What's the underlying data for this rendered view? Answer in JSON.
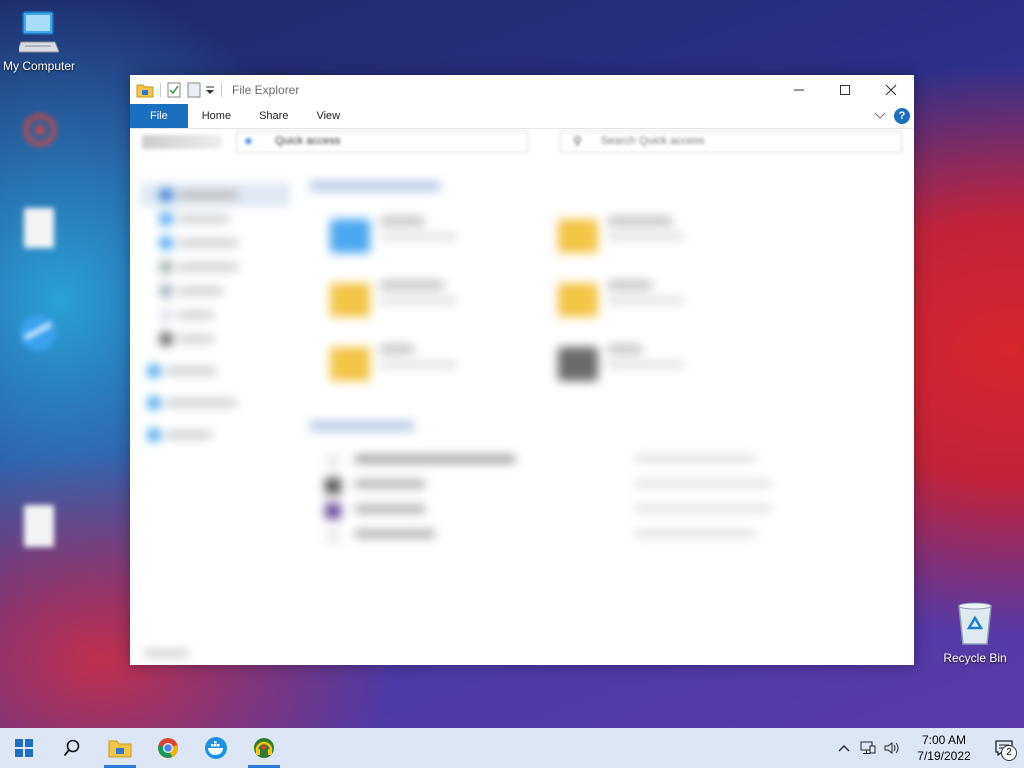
{
  "desktop": {
    "icons": [
      {
        "label": "My Computer",
        "icon": "computer-icon"
      },
      {
        "label": "Recycle Bin",
        "icon": "recycle-bin-icon"
      }
    ]
  },
  "explorer": {
    "title": "File Explorer",
    "tabs": [
      {
        "label": "File"
      },
      {
        "label": "Home"
      },
      {
        "label": "Share"
      },
      {
        "label": "View"
      }
    ],
    "help_label": "?",
    "address": "Quick access",
    "search_placeholder": "Search Quick access"
  },
  "taskbar": {
    "pinned": [
      {
        "icon": "file-explorer-icon",
        "active": true
      },
      {
        "icon": "chrome-icon",
        "active": false
      },
      {
        "icon": "docker-icon",
        "active": false
      },
      {
        "icon": "headphone-app-icon",
        "active": true
      }
    ],
    "clock": {
      "time": "7:00 AM",
      "date": "7/19/2022"
    },
    "notification_count": "2"
  },
  "colors": {
    "accent": "#1a6fc1",
    "taskbar_bg": "#dde6f4"
  }
}
